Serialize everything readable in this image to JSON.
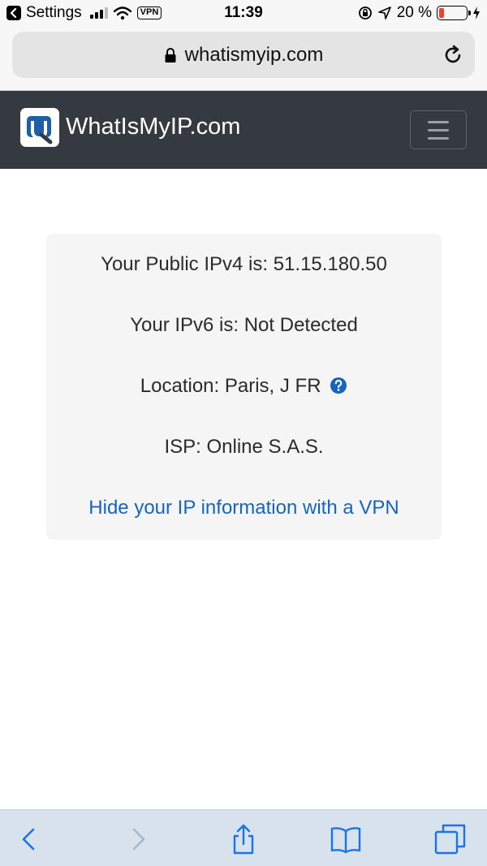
{
  "status_bar": {
    "back_app": "Settings",
    "vpn": "VPN",
    "time": "11:39",
    "battery": "20 %",
    "battery_level": 0.2,
    "battery_color": "#ff3b30"
  },
  "browser": {
    "url": "whatismyip.com",
    "toolbar_icons": [
      "back-icon",
      "forward-icon",
      "share-icon",
      "bookmarks-icon",
      "tabs-icon"
    ]
  },
  "site": {
    "brand": "WhatIsMyIP.com",
    "nav_color": "#343a40"
  },
  "info": {
    "ipv4": "Your Public IPv4 is: 51.15.180.50",
    "ipv6": "Your IPv6 is: Not Detected",
    "location": "Location: Paris, J FR",
    "isp": "ISP: Online S.A.S.",
    "vpn_link": "Hide your IP information with a VPN",
    "link_color": "#1565c0"
  }
}
